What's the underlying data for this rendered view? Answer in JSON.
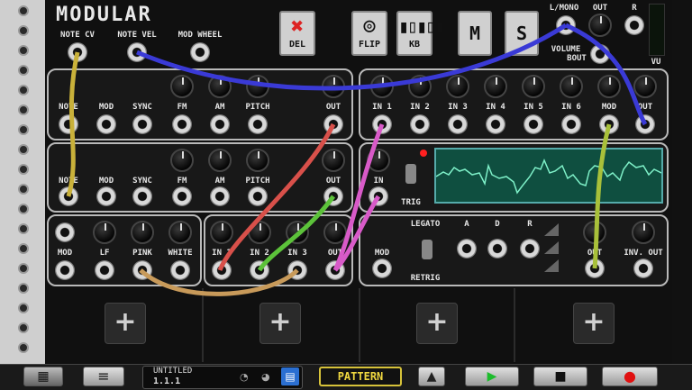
{
  "app_title": "MODULAR",
  "header": {
    "note_cv": "NOTE CV",
    "note_vel": "NOTE VEL",
    "mod_wheel": "MOD WHEEL",
    "del": "DEL",
    "flip": "FLIP",
    "kb": "KB",
    "m": "M",
    "s": "S",
    "l_mono": "L/MONO",
    "out": "OUT",
    "r": "R",
    "volume": "VOLUME",
    "bout": "BOUT",
    "vu": "VU"
  },
  "osc1": {
    "labels": [
      "NOTE",
      "MOD",
      "SYNC",
      "FM",
      "AM",
      "PITCH",
      "OUT"
    ]
  },
  "osc2": {
    "labels": [
      "NOTE",
      "MOD",
      "SYNC",
      "FM",
      "AM",
      "PITCH",
      "OUT"
    ]
  },
  "mixer": {
    "labels": [
      "IN 1",
      "IN 2",
      "IN 3",
      "IN 4",
      "IN 5",
      "IN 6",
      "MOD",
      "OUT"
    ]
  },
  "scope": {
    "labels": [
      "IN",
      "TRIG"
    ]
  },
  "noise": {
    "labels": [
      "MOD",
      "LF",
      "PINK",
      "WHITE"
    ]
  },
  "mix3": {
    "labels": [
      "IN 1",
      "IN 2",
      "IN 3",
      "OUT"
    ]
  },
  "env": {
    "legato": "LEGATO",
    "a": "A",
    "d": "D",
    "r": "R",
    "mod": "MOD",
    "retrig": "RETRIG",
    "out": "OUT",
    "inv_out": "INV. OUT"
  },
  "add_slots": [
    "+",
    "+",
    "+",
    "+"
  ],
  "bottom": {
    "song_name": "UNTITLED",
    "position": "1.1.1",
    "pattern": "PATTERN"
  },
  "colors": {
    "cable_yellow": "#c9b13a",
    "cable_blue": "#3a3ad6",
    "cable_red": "#d8504a",
    "cable_green": "#5cc23a",
    "cable_pink": "#d85ac8",
    "cable_tan": "#c89a5a",
    "cable_olive": "#a8c03a",
    "scope_trace": "#7ef0c8"
  }
}
